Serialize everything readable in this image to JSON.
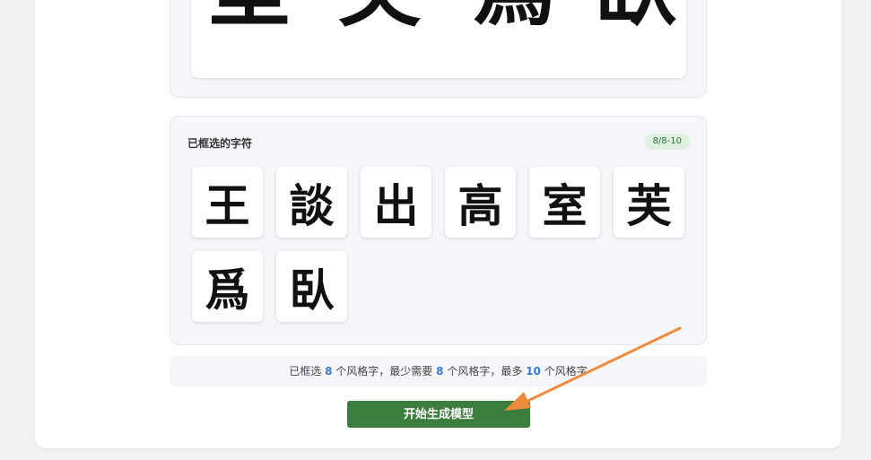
{
  "preview": {
    "characters": [
      "室",
      "芙",
      "爲",
      "臥"
    ]
  },
  "selected": {
    "title": "已框选的字符",
    "badge": "8/8-10",
    "characters": [
      "王",
      "談",
      "出",
      "高",
      "室",
      "芙",
      "爲",
      "臥"
    ]
  },
  "info": {
    "selected_prefix": "已框选",
    "selected_count": "8",
    "selected_suffix": "个风格字，最少需要",
    "min_count": "8",
    "min_suffix": "个风格字，最多",
    "max_count": "10",
    "max_suffix": "个风格字"
  },
  "actions": {
    "generate_label": "开始生成模型"
  },
  "colors": {
    "primary_green": "#3a7d3c",
    "accent_blue": "#3a7bd5",
    "arrow_orange": "#f08a3c"
  }
}
